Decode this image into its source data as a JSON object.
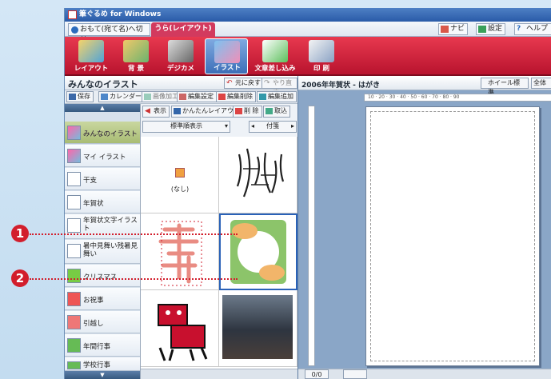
{
  "app": {
    "title": "筆ぐるめ for Windows"
  },
  "tabs": {
    "front": "おもて(宛て名)へ切替",
    "back": "うら(レイアウト)"
  },
  "topbuttons": {
    "navi": "ナビ",
    "settings": "設定",
    "help": "ヘルプ"
  },
  "ribbon": [
    {
      "label": "レイアウト"
    },
    {
      "label": "背 景"
    },
    {
      "label": "デジカメ"
    },
    {
      "label": "イラスト"
    },
    {
      "label": "文章差し込み"
    },
    {
      "label": "印 刷"
    }
  ],
  "panel": {
    "title": "みんなのイラスト",
    "undo": "元に戻す",
    "redo": "やり直す"
  },
  "toolbar1": {
    "save": "保存",
    "calendar": "カレンダー",
    "imageedit": "画像加工",
    "sec1": "編集設定",
    "sec2": "編集削除",
    "sec3": "編集追加"
  },
  "toolbar2": {
    "display": "表示",
    "easylayout": "かんたんレイアウト",
    "delete": "削 除",
    "import": "取込"
  },
  "sortbar": {
    "order": "標準順表示",
    "tag": "付箋"
  },
  "sidebar": [
    {
      "label": "みんなのイラスト"
    },
    {
      "label": "マイ イラスト"
    },
    {
      "label": "干支"
    },
    {
      "label": "年賀状"
    },
    {
      "label": "年賀状文字イラスト"
    },
    {
      "label": "暑中見舞い残暑見舞い"
    },
    {
      "label": "クリスマス"
    },
    {
      "label": "お祝事"
    },
    {
      "label": "引越し"
    },
    {
      "label": "年間行事"
    },
    {
      "label": "学校行事"
    }
  ],
  "grid": {
    "none_label": "(なし)"
  },
  "preview": {
    "title": "2006年年賀状 - はがき",
    "wheel": "ホイール標準",
    "whole": "全体を",
    "page_counter": "0/0",
    "ruler_h": "10 · 20 · 30 · 40 · 50 · 60 · 70 · 80 · 90"
  },
  "callouts": [
    "1",
    "2"
  ],
  "colors": {
    "ribbon": "#d4223e",
    "accent": "#d21e2c",
    "selected_tab": "#d23a5e"
  }
}
